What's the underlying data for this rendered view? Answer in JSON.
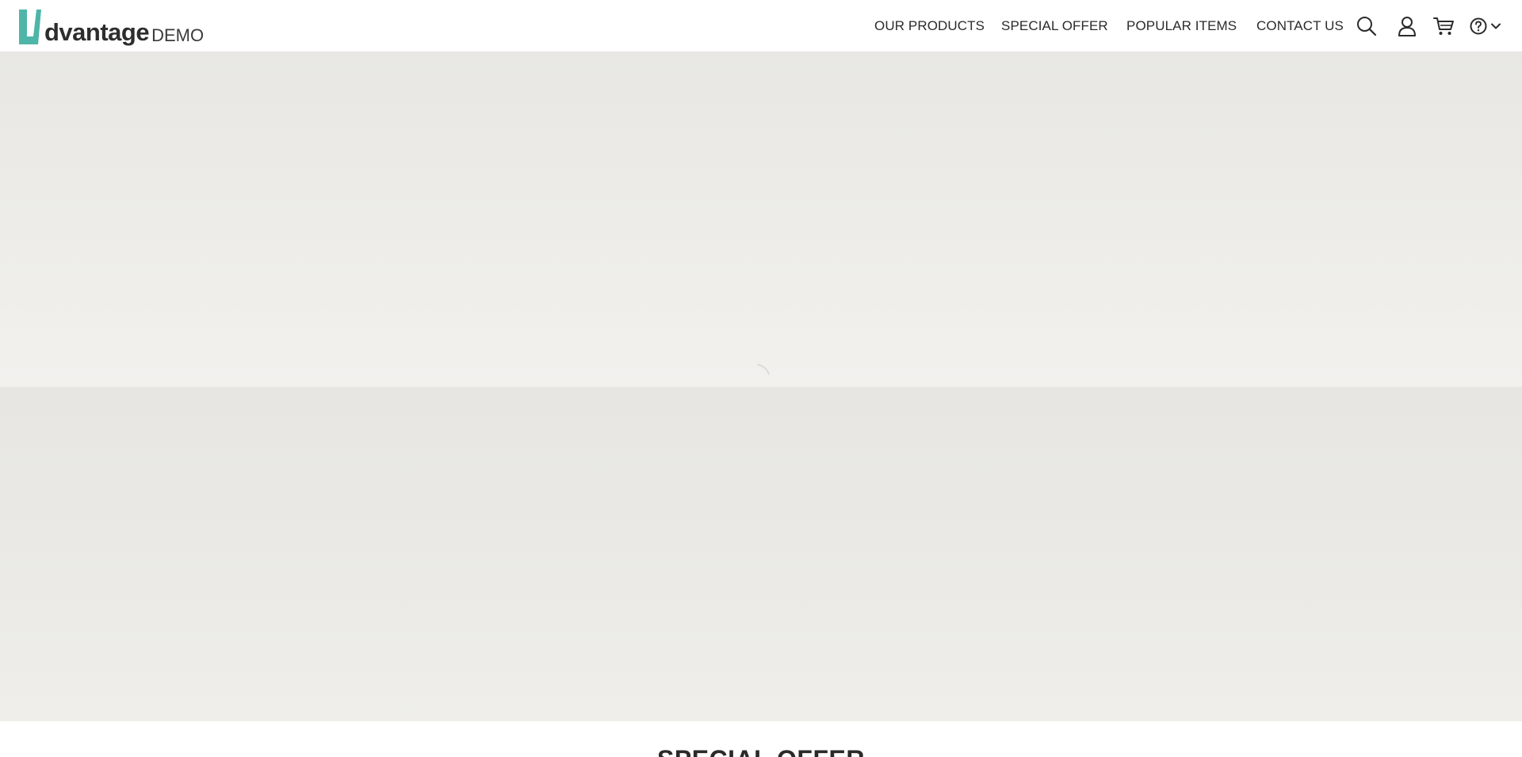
{
  "logo": {
    "word": "dvantage",
    "suffix": "DEMO",
    "accent_color": "#4fb5a8"
  },
  "nav": {
    "items": [
      {
        "label": "OUR PRODUCTS"
      },
      {
        "label": "SPECIAL OFFER"
      },
      {
        "label": "POPULAR ITEMS"
      },
      {
        "label": "CONTACT US"
      }
    ]
  },
  "icons": {
    "search": "search-icon",
    "user": "user-icon",
    "cart": "cart-icon",
    "help": "help-icon",
    "chevron": "chevron-down-icon"
  },
  "main": {
    "section_title": "SPECIAL OFFER"
  }
}
